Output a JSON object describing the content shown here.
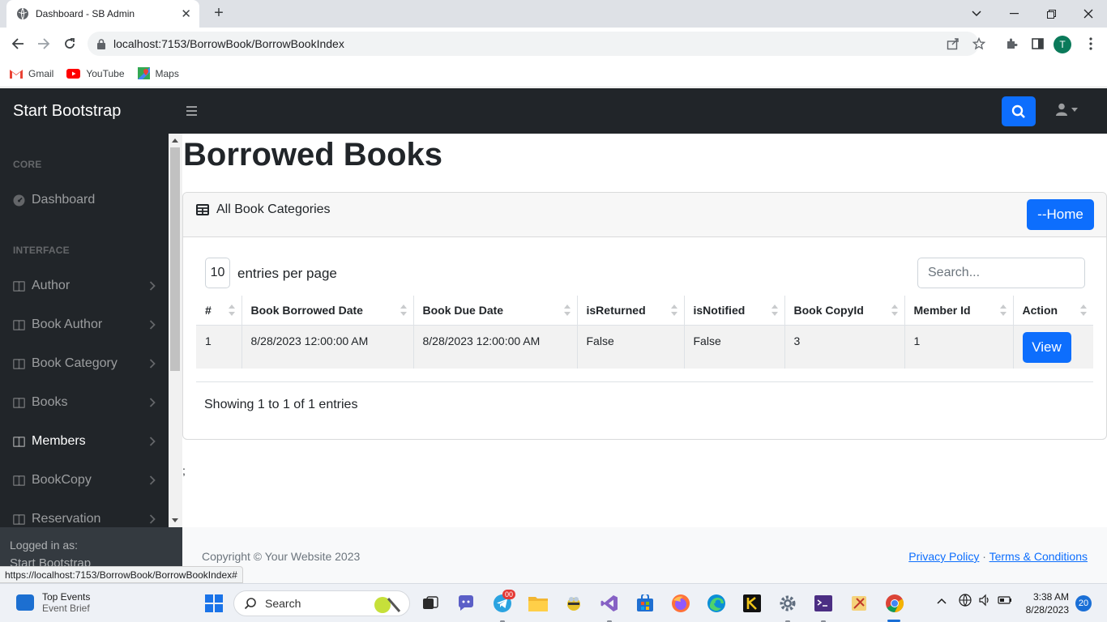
{
  "browser": {
    "tab_title": "Dashboard - SB Admin",
    "url": "localhost:7153/BorrowBook/BorrowBookIndex",
    "profile_initial": "T",
    "bookmarks": [
      "Gmail",
      "YouTube",
      "Maps"
    ],
    "status_url": "https://localhost:7153/BorrowBook/BorrowBookIndex#"
  },
  "app": {
    "brand": "Start Bootstrap",
    "sidebar": {
      "headings": [
        "Core",
        "Interface"
      ],
      "dashboard": "Dashboard",
      "items": [
        "Author",
        "Book Author",
        "Book Category",
        "Books",
        "Members",
        "BookCopy",
        "Reservation"
      ],
      "active_item": "Members",
      "footer_label": "Logged in as:",
      "footer_name": "Start Bootstrap"
    },
    "page_title": "Borrowed Books",
    "card": {
      "title": "All Book Categories",
      "home_button": "--Home"
    },
    "datatable": {
      "per_page_value": "10",
      "per_page_label": "entries per page",
      "search_placeholder": "Search...",
      "columns": [
        "#",
        "Book Borrowed Date",
        "Book Due Date",
        "isReturned",
        "isNotified",
        "Book CopyId",
        "Member Id",
        "Action"
      ],
      "rows": [
        [
          "1",
          "8/28/2023 12:00:00 AM",
          "8/28/2023 12:00:00 AM",
          "False",
          "False",
          "3",
          "1",
          "View"
        ]
      ],
      "info": "Showing 1 to 1 of 1 entries"
    },
    "stray_text": ";",
    "footer": {
      "copyright": "Copyright © Your Website 2023",
      "privacy": "Privacy Policy",
      "separator": "·",
      "terms": "Terms & Conditions"
    }
  },
  "taskbar": {
    "widget_title": "Top Events",
    "widget_subtitle": "Event Brief",
    "search_label": "Search",
    "telegram_badge": "00",
    "time": "3:38 AM",
    "date": "8/28/2023",
    "notification_count": "20"
  },
  "colors": {
    "primary": "#0d6efd",
    "sidebar_bg": "#212529",
    "taskbar_bg": "#eef1f6"
  }
}
